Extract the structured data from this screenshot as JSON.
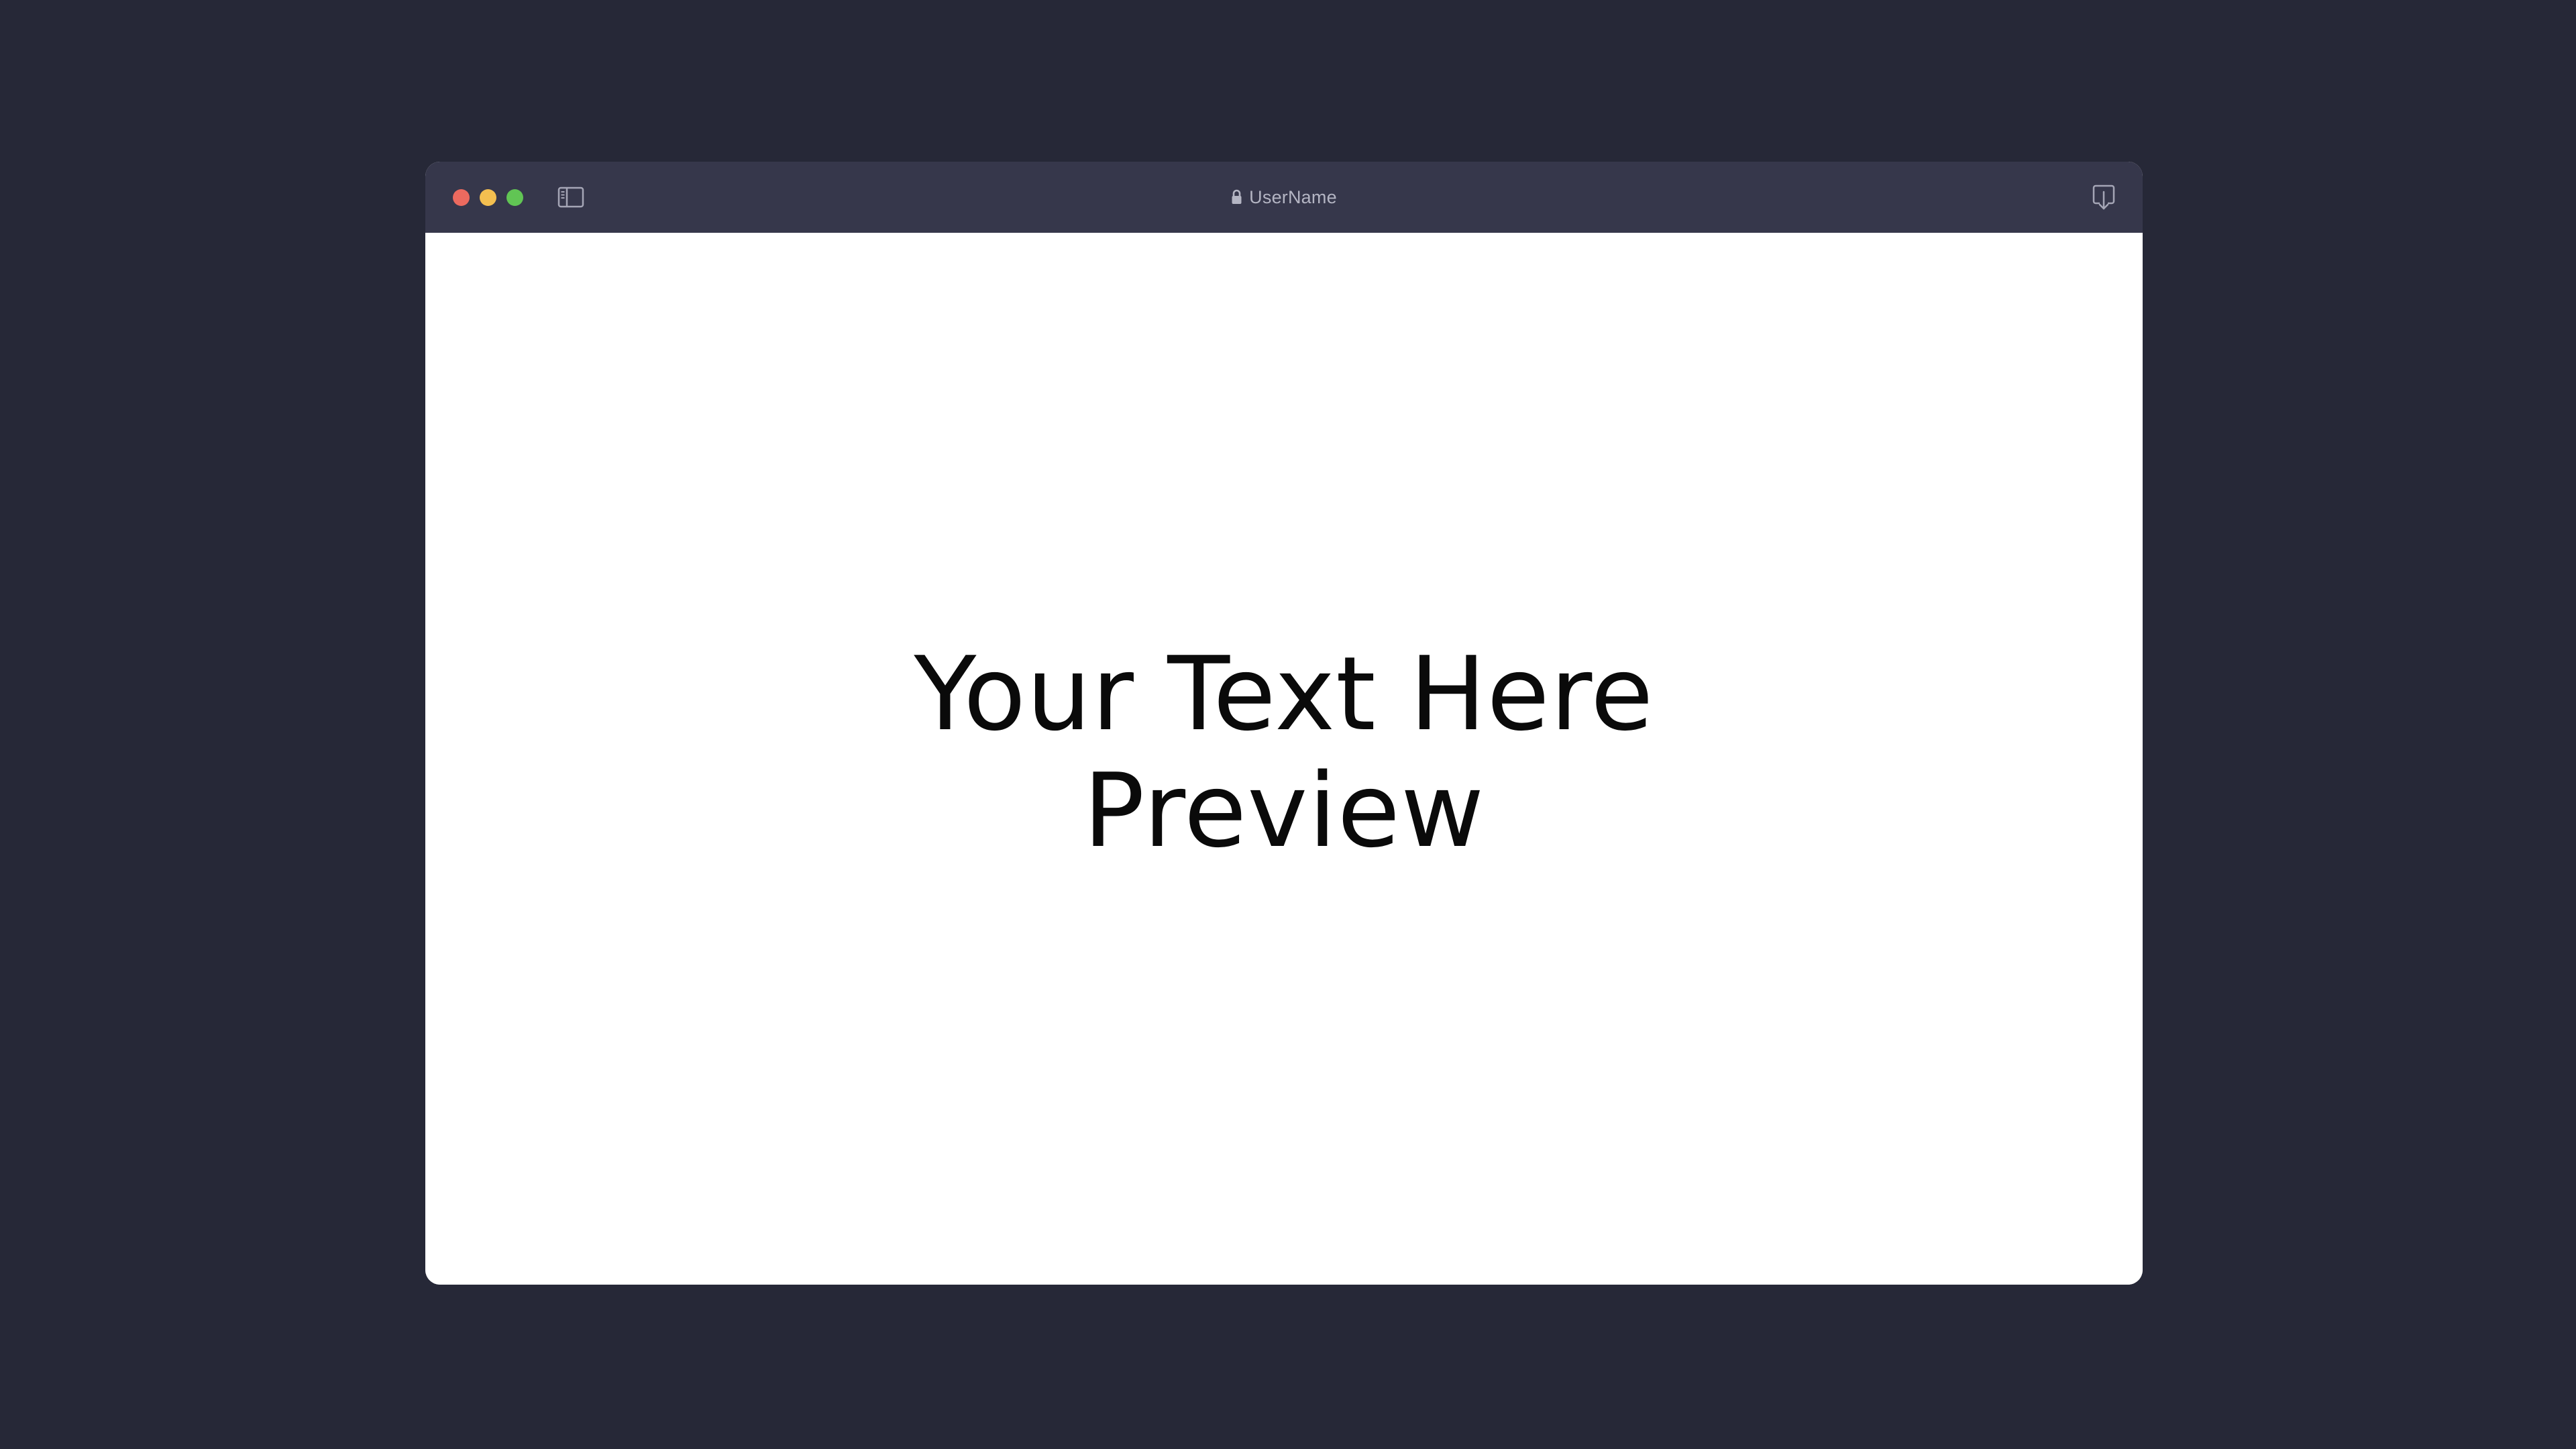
{
  "window": {
    "address_label": "UserName",
    "colors": {
      "background": "#262837",
      "titlebar": "#36374b",
      "close": "#ec6a5f",
      "minimize": "#f4bf50",
      "maximize": "#61c554"
    },
    "icons": {
      "sidebar_toggle": "sidebar-icon",
      "lock": "lock-icon",
      "download": "download-icon"
    }
  },
  "content": {
    "lines": [
      "Your Text Here",
      "Preview"
    ]
  }
}
